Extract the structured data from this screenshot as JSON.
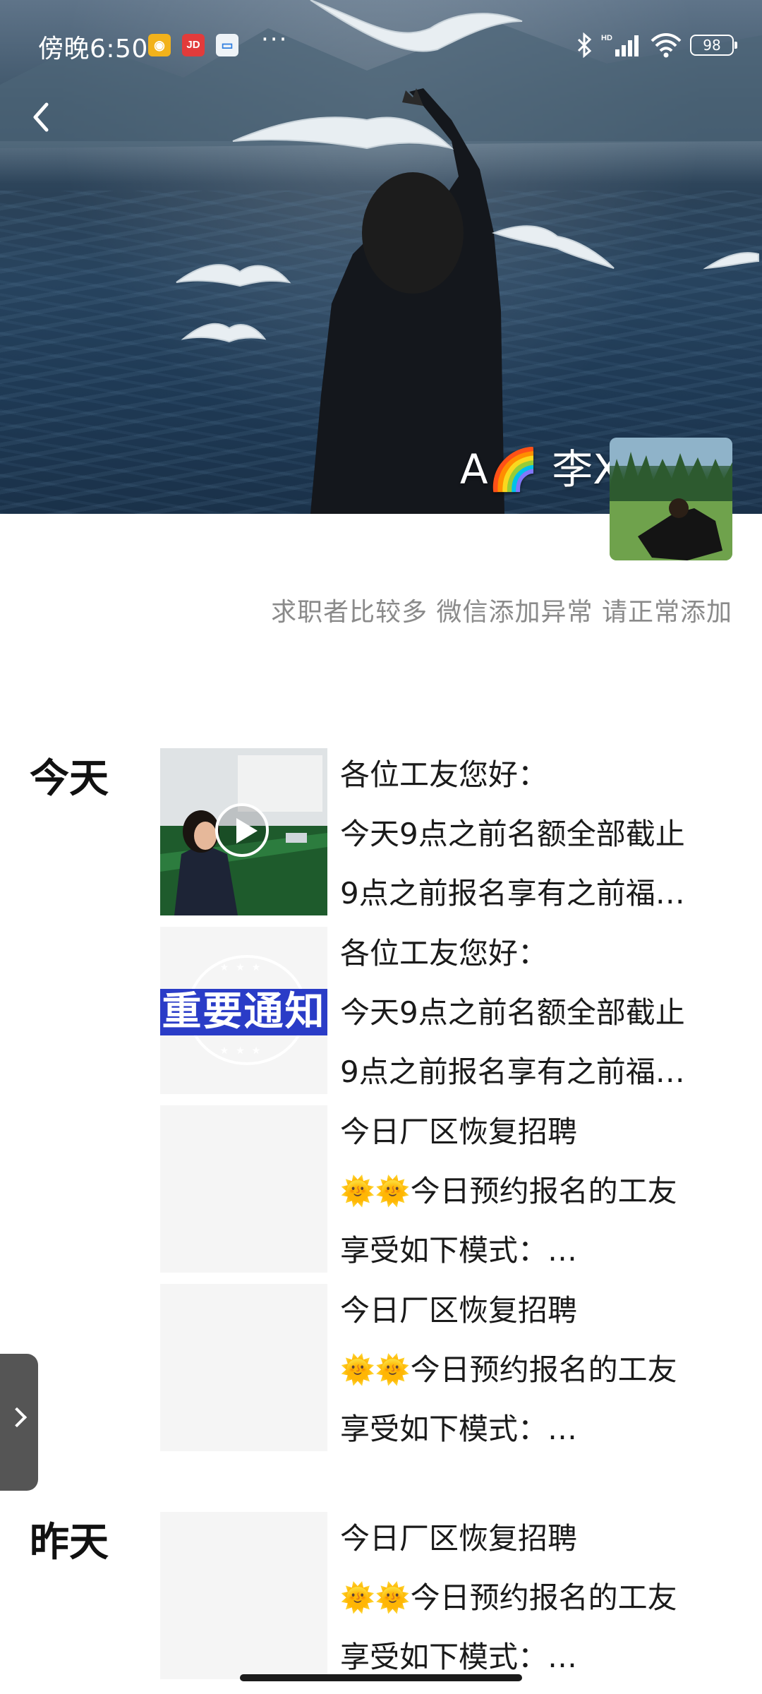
{
  "status_bar": {
    "time": "傍晚6:50",
    "app_icons": [
      {
        "name": "weibo-icon",
        "glyph": "◉",
        "color": "#f2b21b"
      },
      {
        "name": "jd-icon",
        "glyph": "JD",
        "color": "#e23b3b"
      },
      {
        "name": "card-app-icon",
        "glyph": "▭",
        "color": "#2f7fe0"
      }
    ],
    "more": "···",
    "network_label": "HD",
    "battery": "98"
  },
  "profile": {
    "name": "A🌈 李X",
    "signature": "求职者比较多 微信添加异常 请正常添加"
  },
  "sections": [
    {
      "date": "今天",
      "posts": [
        {
          "thumb": "photo",
          "lines": [
            "各位工友您好：",
            "今天9点之前名额全部截止",
            "9点之前报名享有之前福…"
          ]
        },
        {
          "thumb": "notice",
          "notice_text": "重要通知",
          "lines": [
            "各位工友您好：",
            "今天9点之前名额全部截止",
            "9点之前报名享有之前福…"
          ]
        },
        {
          "thumb": "blank",
          "lines": [
            "今日厂区恢复招聘",
            "今日预约报名的工友",
            "享受如下模式：…"
          ],
          "emoji": "🌞🌞"
        },
        {
          "thumb": "blank",
          "lines": [
            "今日厂区恢复招聘",
            "今日预约报名的工友",
            "享受如下模式：…"
          ],
          "emoji": "🌞🌞"
        }
      ]
    },
    {
      "date": "昨天",
      "posts": [
        {
          "thumb": "blank",
          "lines": [
            "今日厂区恢复招聘",
            "今日预约报名的工友",
            "享受如下模式：…"
          ],
          "emoji": "🌞🌞"
        }
      ]
    }
  ]
}
